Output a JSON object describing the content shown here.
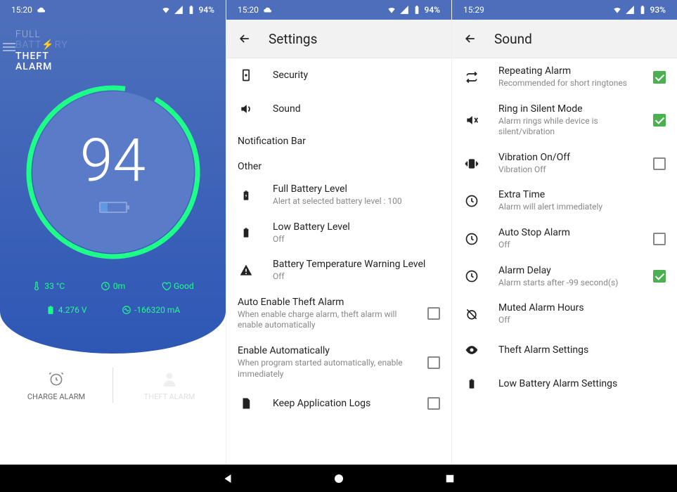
{
  "screen1": {
    "status": {
      "time": "15:20",
      "battery": "94%"
    },
    "app_title": {
      "l1": "FULL",
      "l2": "BATT⚡RY",
      "l3": "THEFT",
      "l4": "ALARM"
    },
    "percent": "94",
    "stats": {
      "temp": "33 °C",
      "time": "0m",
      "health": "Good",
      "voltage": "4.276 V",
      "current": "-166320 mA"
    },
    "tabs": {
      "charge": "CHARGE ALARM",
      "theft": "THEFT ALARM"
    }
  },
  "screen2": {
    "status": {
      "time": "15:20",
      "battery": "94%"
    },
    "title": "Settings",
    "items": {
      "security": "Security",
      "sound": "Sound"
    },
    "section_notif": "Notification Bar",
    "section_other": "Other",
    "full_batt": {
      "title": "Full Battery Level",
      "sub": "Alert at selected battery level : 100"
    },
    "low_batt": {
      "title": "Low Battery Level",
      "sub": "Off"
    },
    "temp_warn": {
      "title": "Battery Temperature Warning Level",
      "sub": "Off"
    },
    "auto_theft": {
      "title": "Auto Enable Theft Alarm",
      "sub": "When enable charge alarm, theft alarm will enable automatically"
    },
    "auto_enable": {
      "title": "Enable Automatically",
      "sub": "When program started automatically, enable immediately"
    },
    "keep_logs": {
      "title": "Keep Application Logs"
    }
  },
  "screen3": {
    "status": {
      "time": "15:29",
      "battery": "93%"
    },
    "title": "Sound",
    "repeating": {
      "title": "Repeating Alarm",
      "sub": "Recommended for short ringtones"
    },
    "silent": {
      "title": "Ring in Silent Mode",
      "sub": "Alarm rings while device is silent/vibration"
    },
    "vibration": {
      "title": "Vibration On/Off",
      "sub": "Vibration Off"
    },
    "extra": {
      "title": "Extra Time",
      "sub": "Alarm will alert immediately"
    },
    "autostop": {
      "title": "Auto Stop Alarm",
      "sub": "Off"
    },
    "delay": {
      "title": "Alarm Delay",
      "sub": "Alarm starts after -99 second(s)"
    },
    "muted": {
      "title": "Muted Alarm Hours",
      "sub": "Off"
    },
    "theft": {
      "title": "Theft Alarm Settings"
    },
    "lowbatt": {
      "title": "Low Battery Alarm Settings"
    }
  }
}
